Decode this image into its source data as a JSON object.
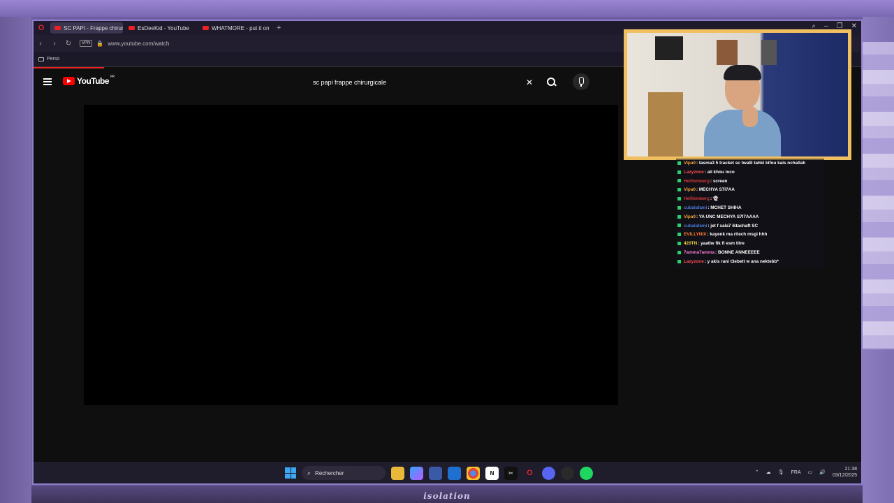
{
  "browser": {
    "tabs": [
      {
        "label": "SC PAPI - Frappe chirurgi",
        "active": true
      },
      {
        "label": "EsDeeKid - YouTube",
        "active": false
      },
      {
        "label": "WHATMORE - put it on he",
        "active": false
      }
    ],
    "new_tab": "+",
    "vpn_label": "VPN",
    "url": "www.youtube.com/watch",
    "bookmark_folder": "Perso"
  },
  "youtube": {
    "logo_text": "YouTube",
    "country_code": "FR",
    "search_query": "sc papi frappe chirurgicale",
    "clear_icon": "✕"
  },
  "taskbar": {
    "search_label": "Rechercher",
    "language": "FRA",
    "time": "21:38",
    "date": "03/12/2025",
    "apps": [
      "file-explorer-icon",
      "copilot-icon",
      "store-icon",
      "outlook-icon",
      "chrome-icon",
      "notion-icon",
      "capcut-icon",
      "opera-icon",
      "discord-icon",
      "obs-icon",
      "spotify-icon"
    ]
  },
  "chat": {
    "messages": [
      {
        "user": "Vipa0",
        "text": ": tasma3 5 tracket sc twalli tahki kifou kais nchallah",
        "color": "#f3a23a"
      },
      {
        "user": "Lazyzone",
        "text": ": ali khou loco",
        "color": "#ff4d4d"
      },
      {
        "user": "Heifiemberg",
        "text": ": screen",
        "color": "#d23b3b"
      },
      {
        "user": "Vipa0",
        "text": ": MECHYA S7I7AA",
        "color": "#f3a23a"
      },
      {
        "user": "Heifiemberg",
        "text": ": 👻",
        "color": "#d23b3b"
      },
      {
        "user": "cubalafami",
        "text": ": MCHET SHIHA",
        "color": "#4a7ad8"
      },
      {
        "user": "Vipa0",
        "text": ": YA UNC MECHYA S7I7AAAA",
        "color": "#f3a23a"
      },
      {
        "user": "cubalafami",
        "text": ": jet f sala7 iktachaft SC",
        "color": "#4a7ad8"
      },
      {
        "user": "EVILLYNIX",
        "text": ": kayenk ma ritech msgi hhh",
        "color": "#ff7a2e"
      },
      {
        "user": "420TN",
        "text": ": yaatiw fik fi esm titre",
        "color": "#f0d240"
      },
      {
        "user": "7amma7amma",
        "text": ": BONNE ANNEEEEE",
        "color": "#ff7ad8"
      },
      {
        "user": "Lazyzone",
        "text": ": y akis rani t3ebett w ana nektebb*",
        "color": "#ff4d4d"
      }
    ]
  },
  "overlay": {
    "footer_logo": "isolation"
  }
}
